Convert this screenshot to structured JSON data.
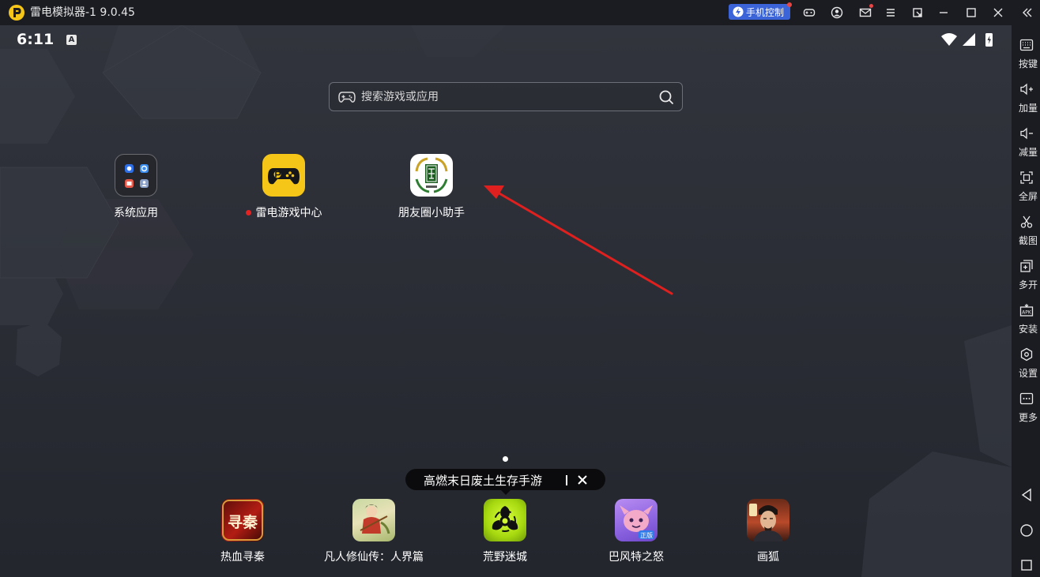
{
  "window": {
    "title": "雷电模拟器-1 9.0.45",
    "phone_control_label": "手机控制"
  },
  "status_bar": {
    "time": "6:11",
    "notification_letter": "A"
  },
  "search": {
    "placeholder": "搜索游戏或应用"
  },
  "apps": [
    {
      "label": "系统应用"
    },
    {
      "label": "雷电游戏中心",
      "badge": true
    },
    {
      "label": "朋友圈小助手"
    }
  ],
  "promo": {
    "text": "高燃末日废土生存手游"
  },
  "dock": [
    {
      "label": "热血寻秦",
      "icon_text": "寻秦"
    },
    {
      "label": "凡人修仙传：人界篇"
    },
    {
      "label": "荒野迷城"
    },
    {
      "label": "巴风特之怒",
      "icon_text": "正版"
    },
    {
      "label": "画狐"
    }
  ],
  "sidebar": [
    {
      "label": "按键",
      "icon": "keyboard-icon"
    },
    {
      "label": "加量",
      "icon": "volume-up-icon"
    },
    {
      "label": "减量",
      "icon": "volume-down-icon"
    },
    {
      "label": "全屏",
      "icon": "fullscreen-icon"
    },
    {
      "label": "截图",
      "icon": "scissors-icon"
    },
    {
      "label": "多开",
      "icon": "multi-instance-icon"
    },
    {
      "label": "安装",
      "icon": "apk-icon"
    },
    {
      "label": "设置",
      "icon": "settings-icon"
    },
    {
      "label": "更多",
      "icon": "more-icon"
    }
  ],
  "colors": {
    "accent_blue": "#3b64d8",
    "badge_red": "#e42222",
    "arrow_red": "#e0201e",
    "game_center_yellow": "#f5c518"
  }
}
